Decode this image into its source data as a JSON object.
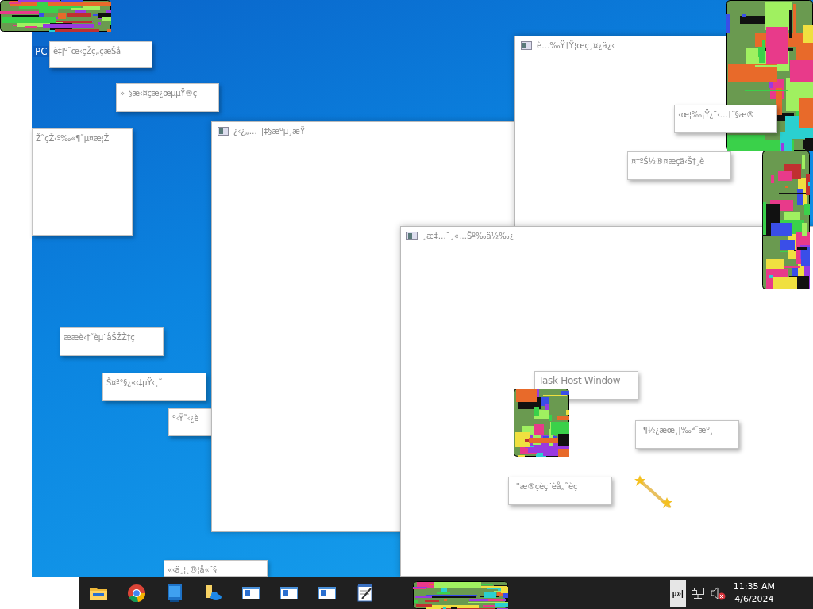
{
  "desktop_icons": [
    {
      "label": "PC"
    }
  ],
  "windows": [
    {
      "title": "¿‹¿„…¨¦‡§æºµ¸æŸ"
    },
    {
      "title": "è…‰Ÿ†Ÿ¦œç¸¤¿ä¿‹"
    },
    {
      "title": "¸æ‡…¯¸«…Šº‰ä½‰¿"
    }
  ],
  "popups": [
    {
      "text": "è‡¦º˜œ‹çŽç„çæŠå"
    },
    {
      "text": "»¨§æ‹¤çæ¿œµµŸ®ç"
    },
    {
      "text": "Ž˜çŽ‹º‰«¶˜µ¤æ¦Ž"
    },
    {
      "text": "ææè‹‡˜èµ¨åŠŽŽ†ç"
    },
    {
      "text": "Š¤ª°§¿«‹‡µŸ‹¸˜"
    },
    {
      "text": "º‹Ÿ˜‹¿è"
    },
    {
      "text": "«‹ä¸¦¸®¦å«¨§"
    },
    {
      "text": "‹œ¦‰¡Ÿ¿¨‹…†¨§æ®"
    },
    {
      "text": "¤‡ºŠ½®¤æçä‹Š†¸è"
    },
    {
      "text": "Task Host Window"
    },
    {
      "text": "¨¶½¿æœ¸¦‰ª˜æº¸"
    },
    {
      "text": "‡''æ®çèç¨èå„˜èç"
    }
  ],
  "taskbar": {
    "apps": [
      {
        "kind": "folder"
      },
      {
        "kind": "browser"
      },
      {
        "kind": "tablet"
      },
      {
        "kind": "cloud-folder"
      },
      {
        "kind": "window"
      },
      {
        "kind": "window"
      },
      {
        "kind": "window"
      },
      {
        "kind": "notepad"
      }
    ],
    "input_indicator": "µ»|",
    "volume_muted": true,
    "time": "11:35 AM",
    "date": "4/6/2024"
  }
}
